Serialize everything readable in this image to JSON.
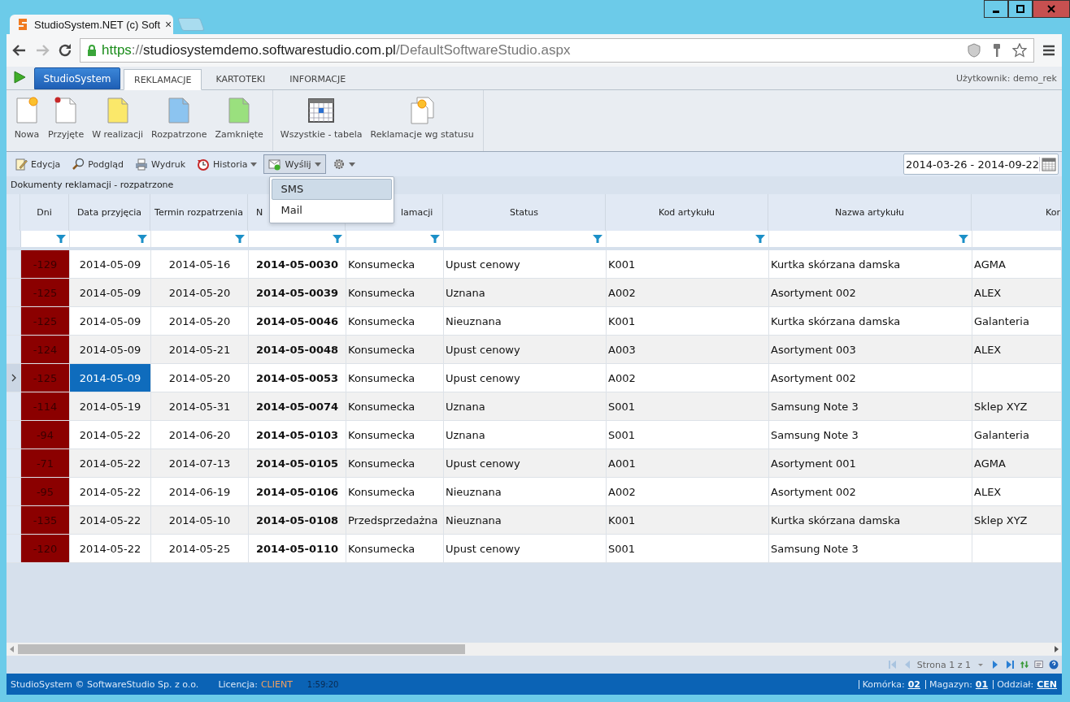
{
  "browser": {
    "tab_title": "StudioSystem.NET (c) Soft",
    "tab_close": "×",
    "url": {
      "scheme": "https",
      "sep": "://",
      "host": "studiosystemdemo.softwarestudio.com.pl",
      "path": "/DefaultSoftwareStudio.aspx"
    }
  },
  "app_bar": {
    "home_button": "StudioSystem",
    "tabs": [
      {
        "label": "REKLAMACJE",
        "selected": true
      },
      {
        "label": "KARTOTEKI",
        "selected": false
      },
      {
        "label": "INFORMACJE",
        "selected": false
      }
    ],
    "user": "Użytkownik: demo_rek"
  },
  "ribbon": {
    "groups": [
      [
        {
          "label": "Nowa",
          "kind": "doc-star"
        },
        {
          "label": "Przyjęte",
          "kind": "doc-pin"
        },
        {
          "label": "W realizacji",
          "kind": "doc-yellow"
        },
        {
          "label": "Rozpatrzone",
          "kind": "doc-blue"
        },
        {
          "label": "Zamknięte",
          "kind": "doc-green"
        }
      ],
      [
        {
          "label": "Wszystkie - tabela",
          "kind": "grid"
        },
        {
          "label": "Reklamacje wg statusu",
          "kind": "docs-star"
        }
      ]
    ]
  },
  "toolbar": {
    "buttons": [
      {
        "label": "Edycja",
        "kind": "edit",
        "dropdown": false,
        "expanded": false
      },
      {
        "label": "Podgląd",
        "kind": "search",
        "dropdown": false,
        "expanded": false
      },
      {
        "label": "Wydruk",
        "kind": "print",
        "dropdown": false,
        "expanded": false
      },
      {
        "label": "Historia",
        "kind": "history",
        "dropdown": true,
        "expanded": false
      },
      {
        "label": "Wyślij",
        "kind": "send",
        "dropdown": true,
        "expanded": true
      },
      {
        "kind": "gear",
        "dropdown": true,
        "expanded": false
      }
    ],
    "menu": [
      {
        "label": "SMS",
        "selected": true
      },
      {
        "label": "Mail",
        "selected": false
      }
    ],
    "date_range": "2014-03-26 - 2014-09-22"
  },
  "grid": {
    "caption": "Dokumenty reklamacji - rozpatrzone",
    "columns": [
      {
        "label": "Dni",
        "kind": "full",
        "filter": true
      },
      {
        "label": "Data przyjęcia",
        "kind": "full",
        "filter": true
      },
      {
        "label": "Termin rozpatrzenia",
        "kind": "full",
        "filter": true
      },
      {
        "label": "N",
        "kind": "cut-right",
        "filter": true
      },
      {
        "label": "lamacji",
        "kind": "cut-left",
        "filter": true
      },
      {
        "label": "Status",
        "kind": "full",
        "filter": true
      },
      {
        "label": "Kod artykułu",
        "kind": "full",
        "filter": true
      },
      {
        "label": "Nazwa artykułu",
        "kind": "full",
        "filter": true
      },
      {
        "label": "Kor",
        "kind": "cut-edge",
        "filter": false
      }
    ],
    "rows": [
      {
        "selected": false,
        "cells": [
          "-129",
          "2014-05-09",
          "2014-05-16",
          "2014-05-0030",
          "Konsumecka",
          "Upust cenowy",
          "K001",
          "Kurtka skórzana damska",
          "AGMA"
        ]
      },
      {
        "selected": false,
        "cells": [
          "-125",
          "2014-05-09",
          "2014-05-20",
          "2014-05-0039",
          "Konsumecka",
          "Uznana",
          "A002",
          "Asortyment 002",
          "ALEX"
        ]
      },
      {
        "selected": false,
        "cells": [
          "-125",
          "2014-05-09",
          "2014-05-20",
          "2014-05-0046",
          "Konsumecka",
          "Nieuznana",
          "K001",
          "Kurtka skórzana damska",
          "Galanteria"
        ]
      },
      {
        "selected": false,
        "cells": [
          "-124",
          "2014-05-09",
          "2014-05-21",
          "2014-05-0048",
          "Konsumecka",
          "Upust cenowy",
          "A003",
          "Asortyment 003",
          "ALEX"
        ]
      },
      {
        "selected": true,
        "cells": [
          "-125",
          "2014-05-09",
          "2014-05-20",
          "2014-05-0053",
          "Konsumecka",
          "Upust cenowy",
          "A002",
          "Asortyment 002"
        ]
      },
      {
        "selected": false,
        "cells": [
          "-114",
          "2014-05-19",
          "2014-05-31",
          "2014-05-0074",
          "Konsumecka",
          "Uznana",
          "S001",
          "Samsung Note 3",
          "Sklep XYZ"
        ]
      },
      {
        "selected": false,
        "cells": [
          "-94",
          "2014-05-22",
          "2014-06-20",
          "2014-05-0103",
          "Konsumecka",
          "Uznana",
          "S001",
          "Samsung Note 3",
          "Galanteria"
        ]
      },
      {
        "selected": false,
        "cells": [
          "-71",
          "2014-05-22",
          "2014-07-13",
          "2014-05-0105",
          "Konsumecka",
          "Upust cenowy",
          "A001",
          "Asortyment 001",
          "AGMA"
        ]
      },
      {
        "selected": false,
        "cells": [
          "-95",
          "2014-05-22",
          "2014-06-19",
          "2014-05-0106",
          "Konsumecka",
          "Nieuznana",
          "A002",
          "Asortyment 002",
          "ALEX"
        ]
      },
      {
        "selected": false,
        "cells": [
          "-135",
          "2014-05-22",
          "2014-05-10",
          "2014-05-0108",
          "Przedsprzedażna",
          "Nieuznana",
          "K001",
          "Kurtka skórzana damska",
          "Sklep XYZ"
        ]
      },
      {
        "selected": false,
        "cells": [
          "-120",
          "2014-05-22",
          "2014-05-25",
          "2014-05-0110",
          "Konsumecka",
          "Upust cenowy",
          "S001",
          "Samsung Note 3"
        ]
      }
    ],
    "pager": "Strona 1 z 1"
  },
  "status_bar": {
    "copyright": "StudioSystem © SoftwareStudio Sp. z o.o.",
    "license_label": "Licencja:",
    "license": "CLIENT",
    "time": "1:59:20",
    "fields": [
      {
        "label": "Komórka:",
        "value": "02"
      },
      {
        "label": "Magazyn:",
        "value": "01"
      },
      {
        "label": "Oddział:",
        "value": "CEN"
      }
    ]
  }
}
